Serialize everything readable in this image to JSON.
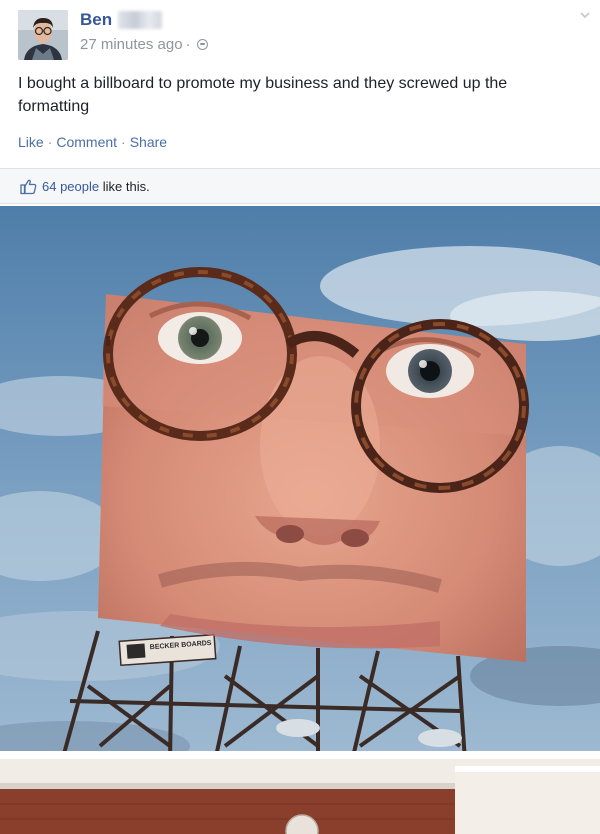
{
  "post": {
    "author": "Ben",
    "timestamp": "27 minutes ago",
    "separator": "·",
    "privacy_icon": "globe-icon",
    "text": "I bought a billboard to promote my business and they screwed up the formatting"
  },
  "actions": {
    "like": "Like",
    "comment": "Comment",
    "share": "Share",
    "separator": "·"
  },
  "likes": {
    "count": "64 people",
    "suffix": "like this."
  },
  "photo": {
    "billboard_brand": "BECKER BOARDS"
  },
  "colors": {
    "link": "#365899",
    "action_link": "#4b6ea8",
    "meta_gray": "#90949c",
    "bar_background": "#f6f7f9"
  }
}
